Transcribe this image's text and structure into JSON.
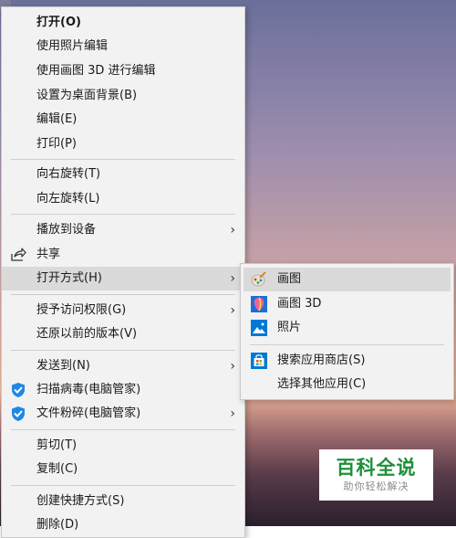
{
  "context_menu": {
    "items": [
      {
        "label": "打开(O)"
      },
      {
        "label": "使用照片编辑"
      },
      {
        "label": "使用画图 3D 进行编辑"
      },
      {
        "label": "设置为桌面背景(B)"
      },
      {
        "label": "编辑(E)"
      },
      {
        "label": "打印(P)"
      },
      {
        "label": "向右旋转(T)"
      },
      {
        "label": "向左旋转(L)"
      },
      {
        "label": "播放到设备"
      },
      {
        "label": "共享"
      },
      {
        "label": "打开方式(H)"
      },
      {
        "label": "授予访问权限(G)"
      },
      {
        "label": "还原以前的版本(V)"
      },
      {
        "label": "发送到(N)"
      },
      {
        "label": "扫描病毒(电脑管家)"
      },
      {
        "label": "文件粉碎(电脑管家)"
      },
      {
        "label": "剪切(T)"
      },
      {
        "label": "复制(C)"
      },
      {
        "label": "创建快捷方式(S)"
      },
      {
        "label": "删除(D)"
      }
    ]
  },
  "open_with_submenu": {
    "items": [
      {
        "label": "画图"
      },
      {
        "label": "画图 3D"
      },
      {
        "label": "照片"
      },
      {
        "label": "搜索应用商店(S)"
      },
      {
        "label": "选择其他应用(C)"
      }
    ]
  },
  "watermark": {
    "title": "百科全说",
    "subtitle": "助你轻松解决"
  },
  "colors": {
    "menu_bg": "#f2f2f2",
    "highlight": "#dadada",
    "watermark_green": "#1f8f3a"
  }
}
